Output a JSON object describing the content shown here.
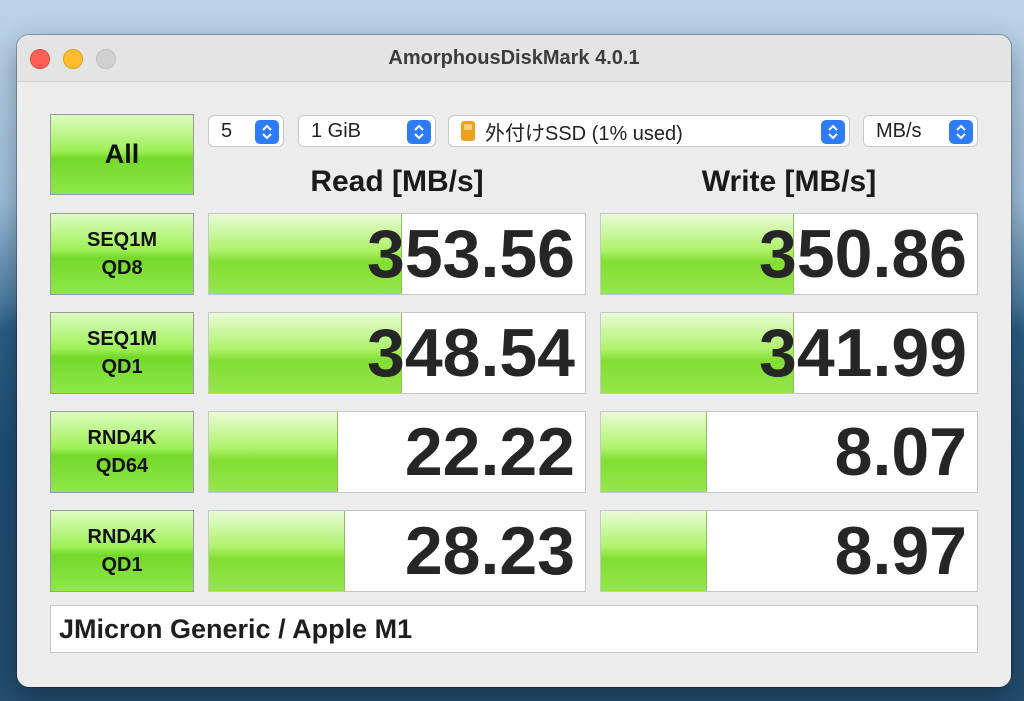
{
  "window": {
    "title": "AmorphousDiskMark 4.0.1"
  },
  "controls": {
    "all_label": "All",
    "count": "5",
    "size": "1 GiB",
    "drive": "外付けSSD (1% used)",
    "unit": "MB/s"
  },
  "headers": {
    "read": "Read [MB/s]",
    "write": "Write [MB/s]"
  },
  "rows": [
    {
      "line1": "SEQ1M",
      "line2": "QD8",
      "read": "353.56",
      "write": "350.86",
      "read_fill": 0.51,
      "write_fill": 0.51
    },
    {
      "line1": "SEQ1M",
      "line2": "QD1",
      "read": "348.54",
      "write": "341.99",
      "read_fill": 0.51,
      "write_fill": 0.51
    },
    {
      "line1": "RND4K",
      "line2": "QD64",
      "read": "22.22",
      "write": "8.07",
      "read_fill": 0.34,
      "write_fill": 0.28
    },
    {
      "line1": "RND4K",
      "line2": "QD1",
      "read": "28.23",
      "write": "8.97",
      "read_fill": 0.36,
      "write_fill": 0.28
    }
  ],
  "footer": {
    "text": "JMicron Generic / Apple M1"
  },
  "colors": {
    "accent": "#2d7cf6",
    "bar_green": "#82de32"
  }
}
